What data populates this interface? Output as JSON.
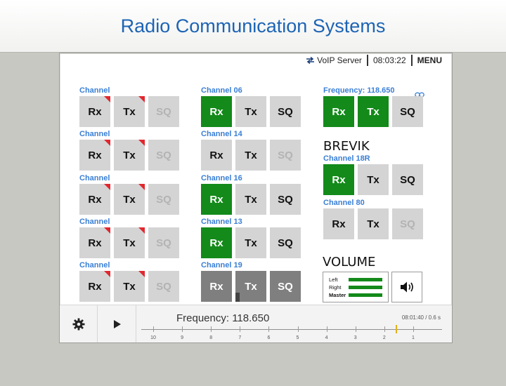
{
  "page_title": "Radio Communication Systems",
  "topbar": {
    "voip_label": "VoIP Server",
    "clock": "08:03:22",
    "menu_label": "MENU"
  },
  "columns": [
    {
      "rows": [
        {
          "label": "Channel",
          "rx": "Rx",
          "tx": "Tx",
          "sq": "SQ",
          "rx_state": "normal",
          "tx_state": "normal",
          "sq_state": "disabled",
          "rx_alert": true,
          "tx_alert": true
        },
        {
          "label": "Channel",
          "rx": "Rx",
          "tx": "Tx",
          "sq": "SQ",
          "rx_state": "normal",
          "tx_state": "normal",
          "sq_state": "disabled",
          "rx_alert": true,
          "tx_alert": true
        },
        {
          "label": "Channel",
          "rx": "Rx",
          "tx": "Tx",
          "sq": "SQ",
          "rx_state": "normal",
          "tx_state": "normal",
          "sq_state": "disabled",
          "rx_alert": true,
          "tx_alert": true
        },
        {
          "label": "Channel",
          "rx": "Rx",
          "tx": "Tx",
          "sq": "SQ",
          "rx_state": "normal",
          "tx_state": "normal",
          "sq_state": "disabled",
          "rx_alert": true,
          "tx_alert": true
        },
        {
          "label": "Channel",
          "rx": "Rx",
          "tx": "Tx",
          "sq": "SQ",
          "rx_state": "normal",
          "tx_state": "normal",
          "sq_state": "disabled",
          "rx_alert": true,
          "tx_alert": true
        }
      ]
    },
    {
      "rows": [
        {
          "label": "Channel 06",
          "rx": "Rx",
          "tx": "Tx",
          "sq": "SQ",
          "rx_state": "active",
          "tx_state": "normal",
          "sq_state": "normal"
        },
        {
          "label": "Channel 14",
          "rx": "Rx",
          "tx": "Tx",
          "sq": "SQ",
          "rx_state": "normal",
          "tx_state": "normal",
          "sq_state": "disabled"
        },
        {
          "label": "Channel 16",
          "rx": "Rx",
          "tx": "Tx",
          "sq": "SQ",
          "rx_state": "active",
          "tx_state": "normal",
          "sq_state": "normal"
        },
        {
          "label": "Channel 13",
          "rx": "Rx",
          "tx": "Tx",
          "sq": "SQ",
          "rx_state": "active",
          "tx_state": "normal",
          "sq_state": "normal"
        },
        {
          "label": "Channel 19",
          "rx": "Rx",
          "tx": "Tx",
          "sq": "SQ",
          "rx_state": "dark",
          "tx_state": "dark",
          "sq_state": "dark"
        }
      ]
    }
  ],
  "right_panel": {
    "frequency": {
      "label": "Frequency: 118.650",
      "rx": "Rx",
      "tx": "Tx",
      "sq": "SQ",
      "rx_state": "active",
      "tx_state": "active",
      "sq_state": "normal"
    },
    "station_title": "BREVIK",
    "channel_18r": {
      "label": "Channel 18R",
      "rx": "Rx",
      "tx": "Tx",
      "sq": "SQ",
      "rx_state": "active",
      "tx_state": "normal",
      "sq_state": "normal"
    },
    "channel_80": {
      "label": "Channel 80",
      "rx": "Rx",
      "tx": "Tx",
      "sq": "SQ",
      "rx_state": "normal",
      "tx_state": "normal",
      "sq_state": "disabled"
    },
    "volume_title": "VOLUME",
    "volume": {
      "left": "Left",
      "right": "Right",
      "master": "Master",
      "left_level": 1.0,
      "right_level": 1.0,
      "master_level": 1.0
    }
  },
  "bottombar": {
    "frequency": "Frequency: 118.650",
    "time": "08:01:40 / 0.6 s",
    "timeline_ticks": [
      "10",
      "9",
      "8",
      "7",
      "6",
      "5",
      "4",
      "3",
      "2",
      "1"
    ],
    "playhead_seconds_ago": 1.6
  },
  "colors": {
    "accent_blue": "#1d64b4",
    "channel_label_blue": "#3a7fd5",
    "active_green": "#138a1a",
    "button_grey": "#d4d4d4",
    "dark_grey": "#7f7f7f",
    "alert_red": "#e1272f",
    "playhead_yellow": "#e2b11b"
  }
}
